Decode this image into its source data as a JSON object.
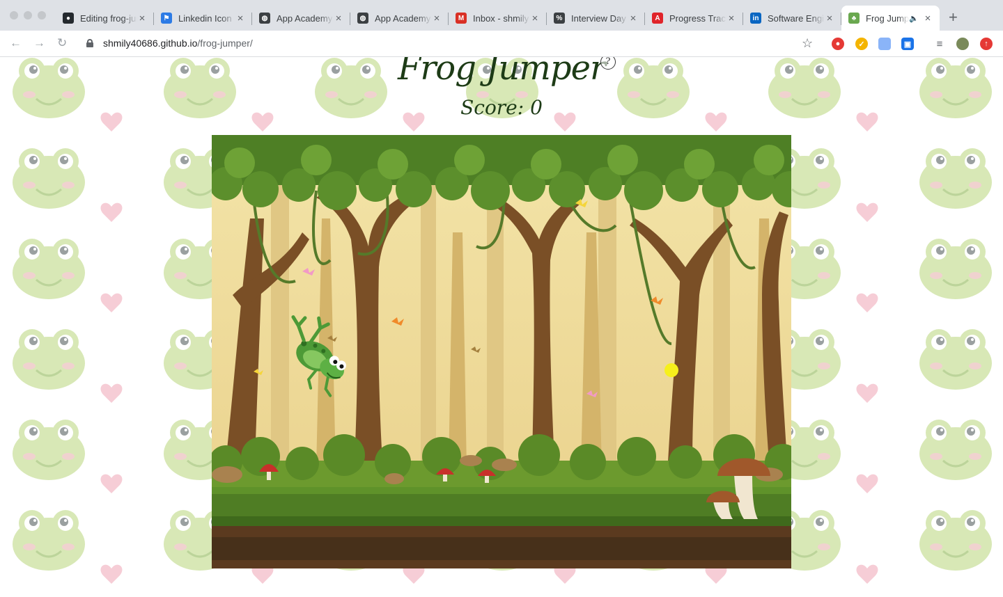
{
  "browser": {
    "tabs": [
      {
        "title": "Editing frog-jumper",
        "favicon": "github-icon",
        "color": "#24292e"
      },
      {
        "title": "Linkedin Icon",
        "favicon": "flag-icon",
        "color": "#2d7be5"
      },
      {
        "title": "App Academy",
        "favicon": "globe-icon",
        "color": "#3c4043"
      },
      {
        "title": "App Academy",
        "favicon": "globe-icon",
        "color": "#3c4043"
      },
      {
        "title": "Inbox - shmily",
        "favicon": "gmail-icon",
        "color": "#d93025"
      },
      {
        "title": "Interview Day",
        "favicon": "interview-icon",
        "color": "#3c4043"
      },
      {
        "title": "Progress Tracker",
        "favicon": "progress-icon",
        "color": "#e0242a"
      },
      {
        "title": "Software Engineer",
        "favicon": "linkedin-icon",
        "color": "#0a66c2"
      },
      {
        "title": "Frog Jumper",
        "favicon": "frog-icon",
        "color": "#6aa84f",
        "active": true,
        "audio": true
      }
    ],
    "new_tab_label": "+",
    "url_host": "shmily40686.github.io",
    "url_path": "/frog-jumper/"
  },
  "page": {
    "title": "Frog Jumper",
    "help_label": "?",
    "score_label": "Score:",
    "score_value": "0"
  },
  "colors": {
    "title_text": "#1d3b16",
    "bg_frog": "#d8e8b6",
    "bg_heart": "#f6cdd6",
    "sky": "#f2dfa2",
    "canopy": "#5c8a2b",
    "ground": "#4f7d24",
    "soil": "#5b3a1f"
  }
}
